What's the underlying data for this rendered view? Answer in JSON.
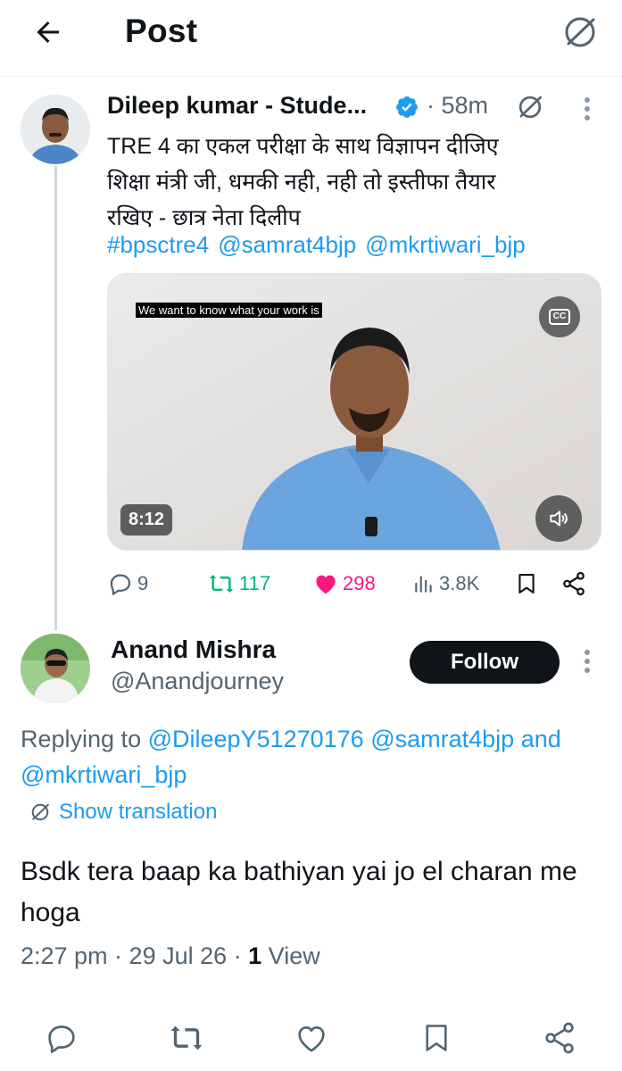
{
  "header": {
    "title": "Post"
  },
  "tweet": {
    "author_name": "Dileep kumar - Stude...",
    "time": "· 58m",
    "text_lines": [
      "TRE 4 का एकल परीक्षा के साथ विज्ञापन दीजिए",
      "शिक्षा मंत्री जी,  धमकी नही, नही तो इस्तीफा तैयार",
      "रखिए - छात्र नेता दिलीप"
    ],
    "tags": [
      "#bpsctre4",
      "@samrat4bjp",
      "@mkrtiwari_bjp"
    ],
    "video": {
      "caption": "We want to know what your work is",
      "cc_label": "CC",
      "duration": "8:12"
    },
    "stats": {
      "replies": "9",
      "retweets": "117",
      "likes": "298",
      "views": "3.8K"
    }
  },
  "reply": {
    "author_name": "Anand Mishra",
    "handle": "@Anandjourney",
    "follow_label": "Follow",
    "replying_prefix": "Replying to",
    "replying_mentions": [
      "@DileepY51270176",
      "@samrat4bjp",
      "@mkrtiwari_bjp"
    ],
    "replying_and": "and",
    "show_translation": "Show translation",
    "text": "Bsdk tera baap ka bathiyan yai jo el charan me hoga",
    "time": "2:27 pm · 29 Jul 26 · ",
    "views_count": "1",
    "views_label": " View"
  },
  "colors": {
    "accent": "#1d9bf0",
    "retweet": "#00ba7c",
    "like": "#f91880",
    "muted": "#536471"
  }
}
